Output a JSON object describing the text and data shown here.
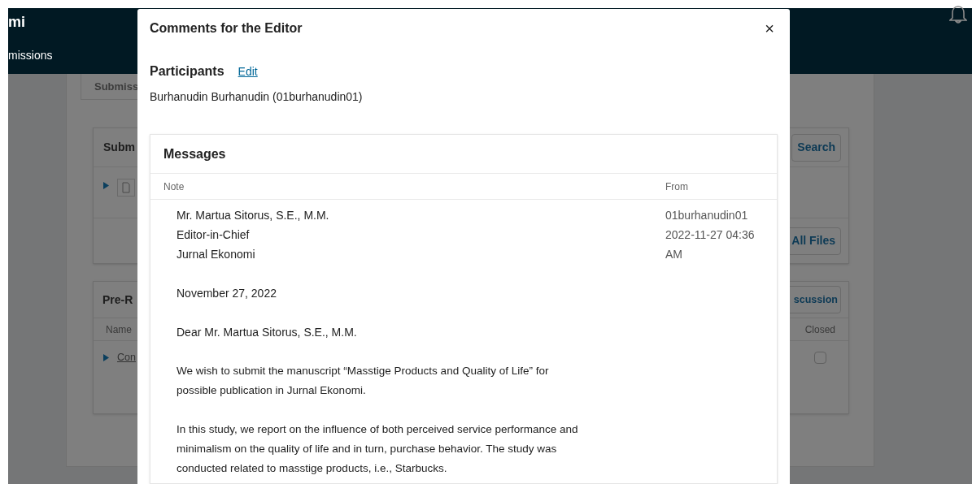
{
  "background": {
    "site_title": "mi",
    "nav_item": "missions",
    "tab": "Submiss",
    "files_panel": {
      "title": "Subm",
      "search_button": "Search",
      "all_files_button": "All Files"
    },
    "discussions_panel": {
      "title": "Pre-R",
      "add_button": "scussion",
      "columns": [
        "Name",
        "Closed"
      ],
      "rows": [
        {
          "name": "Con",
          "closed": false
        }
      ]
    }
  },
  "dialog": {
    "title": "Comments for the Editor",
    "close": "×",
    "participants": {
      "heading": "Participants",
      "edit_link": "Edit",
      "names": [
        "Burhanudin Burhanudin (01burhanudin01)"
      ]
    },
    "messages": {
      "title": "Messages",
      "columns": [
        "Note",
        "From"
      ],
      "rows": [
        {
          "address": [
            "Mr. Martua Sitorus, S.E., M.M.",
            "Editor-in-Chief",
            "Jurnal Ekonomi"
          ],
          "date": "November 27, 2022",
          "salutation": "Dear Mr. Martua Sitorus, S.E., M.M.",
          "paragraphs": [
            [
              "We wish to submit the manuscript “Masstige Products and Quality of Life” for",
              "possible publication in Jurnal Ekonomi."
            ],
            [
              "In this study, we report on the influence of both perceived service performance and",
              "minimalism on the quality of life and in turn, purchase behavior. The study was",
              "conducted related to masstige products, i.e., Starbucks."
            ]
          ],
          "from": [
            "01burhanudin01",
            "2022-11-27 04:36",
            "AM"
          ]
        }
      ]
    }
  }
}
